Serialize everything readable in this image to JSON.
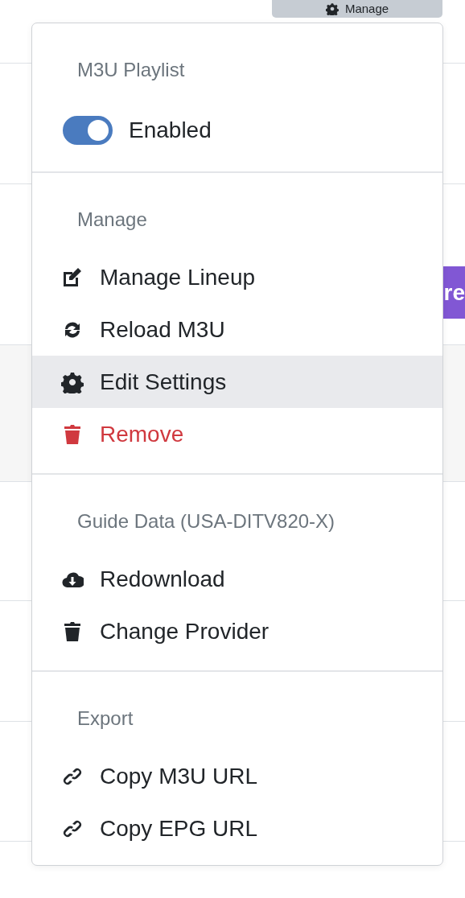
{
  "manage_button": {
    "label": "Manage"
  },
  "background_badge": {
    "text": "re"
  },
  "menu": {
    "sections": [
      {
        "header": "M3U Playlist",
        "items": [
          {
            "kind": "toggle",
            "label": "Enabled",
            "on": true
          }
        ]
      },
      {
        "header": "Manage",
        "items": [
          {
            "kind": "action",
            "label": "Manage Lineup",
            "selected": false
          },
          {
            "kind": "action",
            "label": "Reload M3U",
            "selected": false
          },
          {
            "kind": "action",
            "label": "Edit Settings",
            "selected": true
          },
          {
            "kind": "danger",
            "label": "Remove",
            "selected": false
          }
        ]
      },
      {
        "header": "Guide Data (USA-DITV820-X)",
        "items": [
          {
            "kind": "action",
            "label": "Redownload",
            "selected": false
          },
          {
            "kind": "action",
            "label": "Change Provider",
            "selected": false
          }
        ]
      },
      {
        "header": "Export",
        "items": [
          {
            "kind": "action",
            "label": "Copy M3U URL",
            "selected": false
          },
          {
            "kind": "action",
            "label": "Copy EPG URL",
            "selected": false
          }
        ]
      }
    ]
  }
}
